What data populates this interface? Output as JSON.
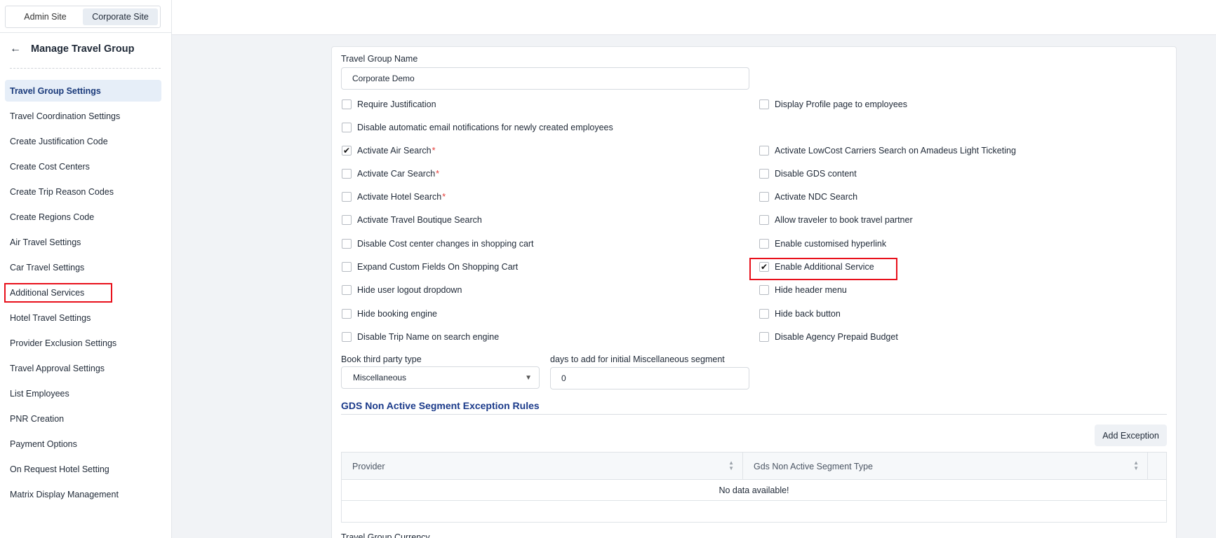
{
  "site_switch": {
    "admin": "Admin Site",
    "corporate": "Corporate Site"
  },
  "sidebar": {
    "back": "←",
    "title": "Manage Travel Group",
    "items": [
      "Travel Group Settings",
      "Travel Coordination Settings",
      "Create Justification Code",
      "Create Cost Centers",
      "Create Trip Reason Codes",
      "Create Regions Code",
      "Air Travel Settings",
      "Car Travel Settings",
      "Additional Services",
      "Hotel Travel Settings",
      "Provider Exclusion Settings",
      "Travel Approval Settings",
      "List Employees",
      "PNR Creation",
      "Payment Options",
      "On Request Hotel Setting",
      "Matrix Display Management"
    ]
  },
  "form": {
    "group_name_label": "Travel Group Name",
    "group_name_value": "Corporate Demo",
    "checkboxes_left": [
      {
        "label": "Require Justification",
        "checked": false,
        "required": false
      },
      {
        "label": "Disable automatic email notifications for newly created employees",
        "checked": false,
        "required": false
      },
      {
        "label": "Activate Air Search",
        "checked": true,
        "required": true
      },
      {
        "label": "Activate Car Search",
        "checked": false,
        "required": true
      },
      {
        "label": "Activate Hotel Search",
        "checked": false,
        "required": true
      },
      {
        "label": "Activate Travel Boutique Search",
        "checked": false,
        "required": false
      },
      {
        "label": "Disable Cost center changes in shopping cart",
        "checked": false,
        "required": false
      },
      {
        "label": "Expand Custom Fields On Shopping Cart",
        "checked": false,
        "required": false
      },
      {
        "label": "Hide user logout dropdown",
        "checked": false,
        "required": false
      },
      {
        "label": "Hide booking engine",
        "checked": false,
        "required": false
      },
      {
        "label": "Disable Trip Name on search engine",
        "checked": false,
        "required": false
      }
    ],
    "checkboxes_right": [
      {
        "label": "Display Profile page to employees",
        "checked": false
      },
      {
        "label": "Activate LowCost Carriers Search on Amadeus Light Ticketing",
        "checked": false
      },
      {
        "label": "Disable GDS content",
        "checked": false
      },
      {
        "label": "Activate NDC Search",
        "checked": false
      },
      {
        "label": "Allow traveler to book travel partner",
        "checked": false
      },
      {
        "label": "Enable customised hyperlink",
        "checked": false
      },
      {
        "label": "Enable Additional Service",
        "checked": true
      },
      {
        "label": "Hide header menu",
        "checked": false
      },
      {
        "label": "Hide back button",
        "checked": false
      },
      {
        "label": "Disable Agency Prepaid Budget",
        "checked": false
      }
    ],
    "required_mark": "*",
    "check_mark": "✔",
    "third_party_label": "Book third party type",
    "third_party_value": "Miscellaneous",
    "days_label": "days to add for initial Miscellaneous segment",
    "days_value": "0"
  },
  "gds": {
    "title": "GDS Non Active Segment Exception Rules",
    "add_button": "Add Exception",
    "columns": [
      "Provider",
      "Gds Non Active Segment Type"
    ],
    "empty_text": "No data available!"
  },
  "cut_label": "Travel Group Currency",
  "colors": {
    "highlight": "#e8101b",
    "accent": "#1a3a8a",
    "required": "#e53935"
  }
}
